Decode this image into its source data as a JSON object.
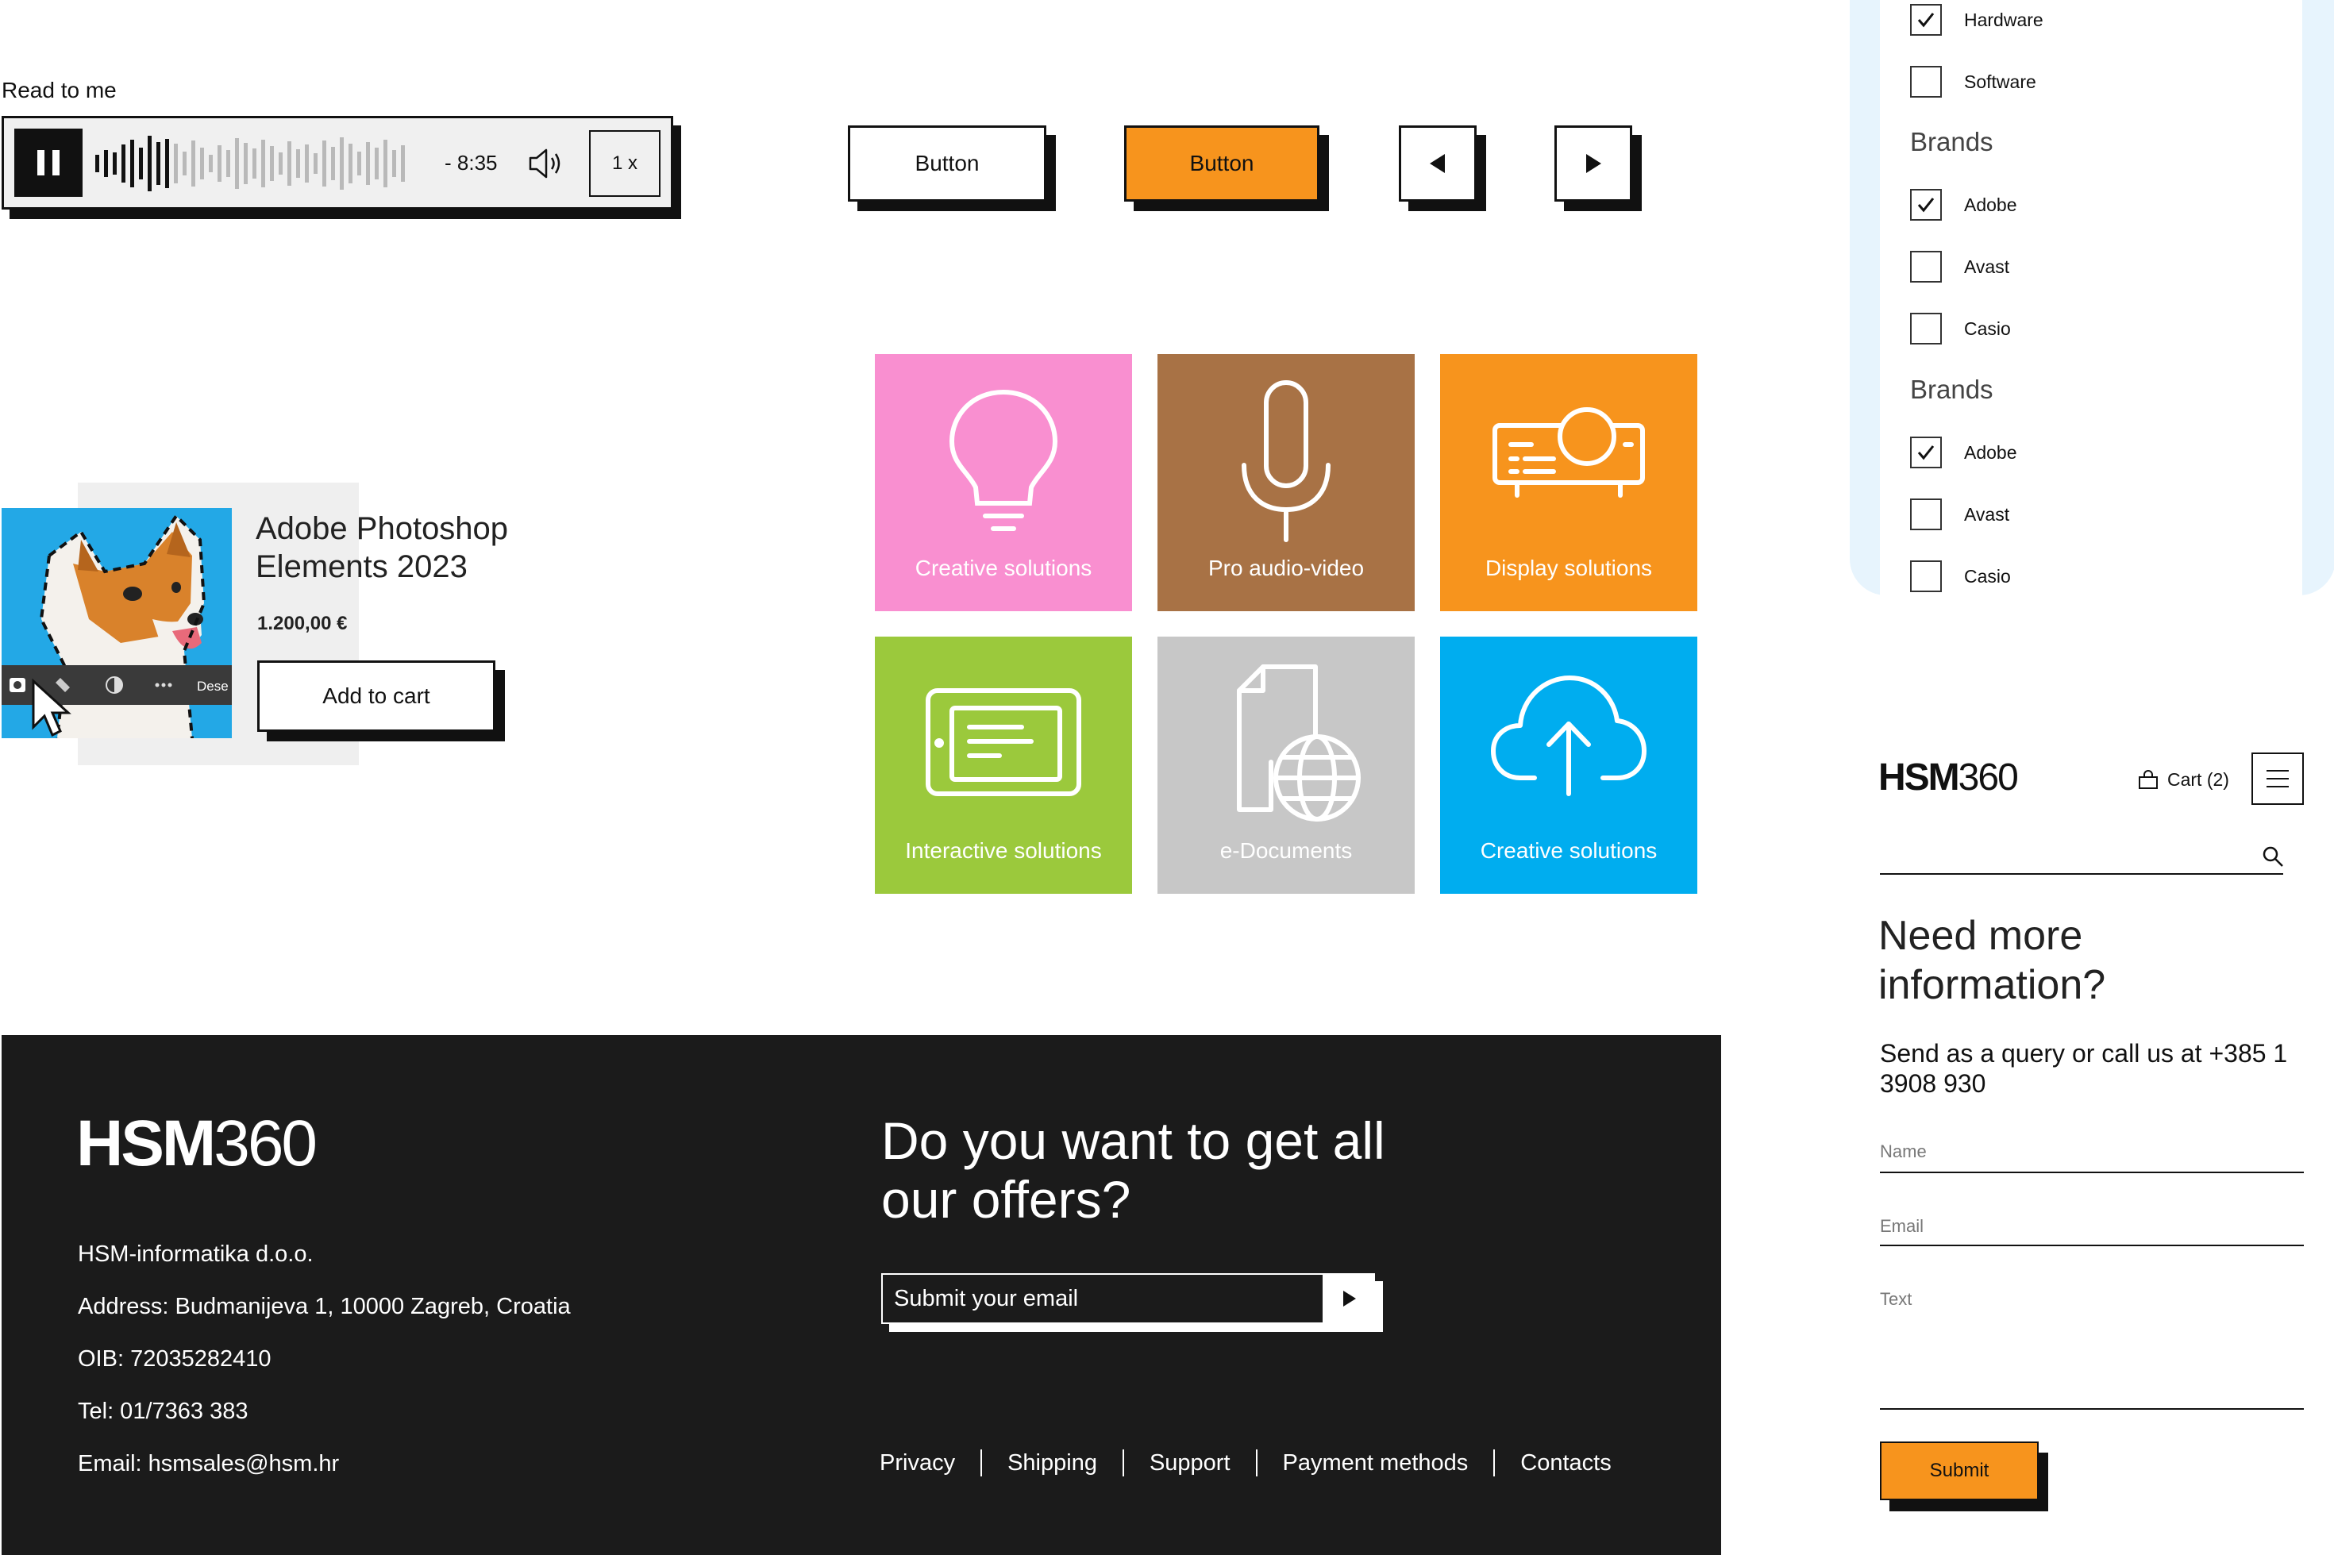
{
  "player": {
    "label": "Read to me",
    "time": "- 8:35",
    "speed": "1 x"
  },
  "buttons": {
    "outline": "Button",
    "primary": "Button"
  },
  "product": {
    "title": "Adobe Photoshop Elements 2023",
    "price": "1.200,00 €",
    "cta": "Add to cart",
    "toolbar_text": "Dese"
  },
  "tiles": [
    {
      "label": "Creative solutions",
      "color": "#f98fd0",
      "icon": "lightbulb-icon"
    },
    {
      "label": "Pro audio-video",
      "color": "#a87245",
      "icon": "microphone-icon"
    },
    {
      "label": "Display solutions",
      "color": "#f7941d",
      "icon": "projector-icon"
    },
    {
      "label": "Interactive solutions",
      "color": "#9bc93c",
      "icon": "tablet-icon"
    },
    {
      "label": "e-Documents",
      "color": "#c7c7c7",
      "icon": "document-globe-icon"
    },
    {
      "label": "Creative solutions",
      "color": "#00adef",
      "icon": "cloud-upload-icon"
    }
  ],
  "filters": {
    "top_items": [
      {
        "label": "Hardware",
        "checked": true
      },
      {
        "label": "Software",
        "checked": false
      }
    ],
    "groups": [
      {
        "title": "Brands",
        "items": [
          {
            "label": "Adobe",
            "checked": true
          },
          {
            "label": "Avast",
            "checked": false
          },
          {
            "label": "Casio",
            "checked": false
          }
        ]
      },
      {
        "title": "Brands",
        "items": [
          {
            "label": "Adobe",
            "checked": true
          },
          {
            "label": "Avast",
            "checked": false
          },
          {
            "label": "Casio",
            "checked": false
          }
        ]
      }
    ]
  },
  "mobile": {
    "logo_bold": "HSM",
    "logo_thin": "360",
    "cart": "Cart (2)",
    "heading": "Need more information?",
    "subtext": "Send as a query or call us at +385 1 3908 930",
    "fields": {
      "name": "Name",
      "email": "Email",
      "text": "Text"
    },
    "submit": "Submit"
  },
  "footer": {
    "logo_bold": "HSM",
    "logo_thin": "360",
    "company": "HSM-informatika d.o.o.",
    "address": "Address: Budmanijeva 1, 10000 Zagreb, Croatia",
    "oib": "OIB: 72035282410",
    "tel": "Tel: 01/7363 383",
    "email": "Email: hsmsales@hsm.hr",
    "offer_heading": "Do you want to get all our offers?",
    "email_placeholder": "Submit your email",
    "links": [
      "Privacy",
      "Shipping",
      "Support",
      "Payment methods",
      "Contacts"
    ]
  },
  "colors": {
    "accent": "#f7941d",
    "panel_bg": "#e7f4fd",
    "footer_bg": "#1b1b1b"
  }
}
